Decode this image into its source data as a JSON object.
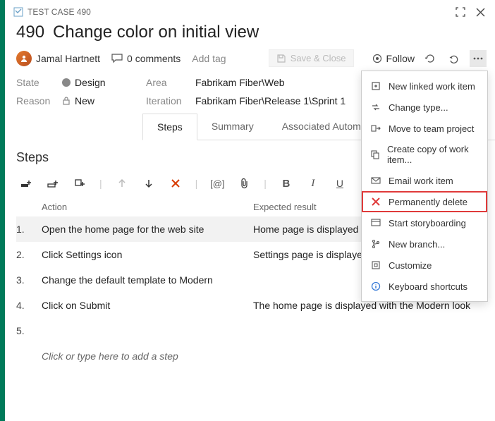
{
  "titlebar": {
    "type_label": "TEST CASE 490"
  },
  "workitem": {
    "id": "490",
    "title": "Change color on initial view"
  },
  "meta": {
    "assignee": "Jamal Hartnett",
    "comments_count": "0 comments",
    "add_tag": "Add tag",
    "save_close": "Save & Close",
    "follow": "Follow"
  },
  "fields": {
    "state_label": "State",
    "state_value": "Design",
    "reason_label": "Reason",
    "reason_value": "New",
    "area_label": "Area",
    "area_value": "Fabrikam Fiber\\Web",
    "iteration_label": "Iteration",
    "iteration_value": "Fabrikam Fiber\\Release 1\\Sprint 1"
  },
  "tabs": {
    "steps": "Steps",
    "summary": "Summary",
    "automation": "Associated Automation"
  },
  "steps": {
    "heading": "Steps",
    "columns": {
      "action": "Action",
      "expected": "Expected result"
    },
    "rows": [
      {
        "num": "1.",
        "action": "Open the home page for the web site",
        "expected": "Home page is displayed"
      },
      {
        "num": "2.",
        "action": "Click Settings icon",
        "expected": "Settings page is displayed"
      },
      {
        "num": "3.",
        "action": "Change the default template to Modern",
        "expected": ""
      },
      {
        "num": "4.",
        "action": "Click on Submit",
        "expected": "The home page is displayed with the Modern look"
      },
      {
        "num": "5.",
        "action": "",
        "expected": ""
      }
    ],
    "placeholder": "Click or type here to add a step"
  },
  "menu": {
    "new_linked": "New linked work item",
    "change_type": "Change type...",
    "move_team": "Move to team project",
    "create_copy": "Create copy of work item...",
    "email": "Email work item",
    "perm_delete": "Permanently delete",
    "storyboard": "Start storyboarding",
    "new_branch": "New branch...",
    "customize": "Customize",
    "shortcuts": "Keyboard shortcuts"
  }
}
